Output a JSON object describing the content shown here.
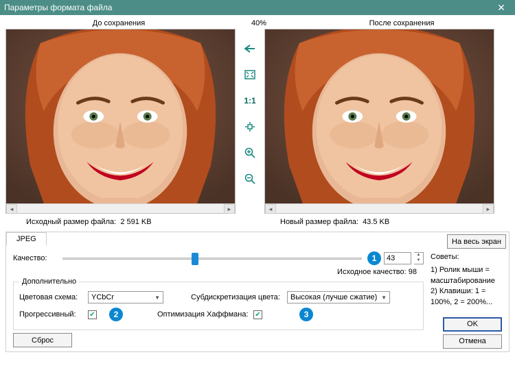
{
  "window": {
    "title": "Параметры формата файла"
  },
  "header": {
    "before_label": "До сохранения",
    "zoom_percent": "40%",
    "after_label": "После сохранения"
  },
  "sizes": {
    "original_label": "Исходный размер файла:",
    "original_value": "2 591 KB",
    "new_label": "Новый размер файла:",
    "new_value": "43.5 KB"
  },
  "tab": {
    "name": "JPEG"
  },
  "buttons": {
    "fullscreen": "На весь экран",
    "reset": "Сброс",
    "ok": "OK",
    "cancel": "Отмена"
  },
  "quality": {
    "label": "Качество:",
    "value": "43",
    "percent": 43,
    "original_label": "Исходное качество:",
    "original_value": "98"
  },
  "advanced": {
    "legend": "Дополнительно",
    "color_scheme_label": "Цветовая схема:",
    "color_scheme_value": "YCbCr",
    "subsampling_label": "Субдискретизация цвета:",
    "subsampling_value": "Высокая (лучше сжатие)",
    "progressive_label": "Прогрессивный:",
    "progressive_checked": true,
    "huffman_label": "Оптимизация Хаффмана:",
    "huffman_checked": true
  },
  "tips": {
    "title": "Советы:",
    "line1": "1) Ролик мыши = масштабирование",
    "line2": "2) Клавиши: 1 = 100%, 2 = 200%..."
  },
  "callouts": {
    "one": "1",
    "two": "2",
    "three": "3"
  },
  "toolbar_icons": {
    "back": "back-icon",
    "fit": "fit-screen-icon",
    "actual": "actual-size-icon",
    "center": "center-icon",
    "zoom_in": "zoom-in-icon",
    "zoom_out": "zoom-out-icon"
  }
}
